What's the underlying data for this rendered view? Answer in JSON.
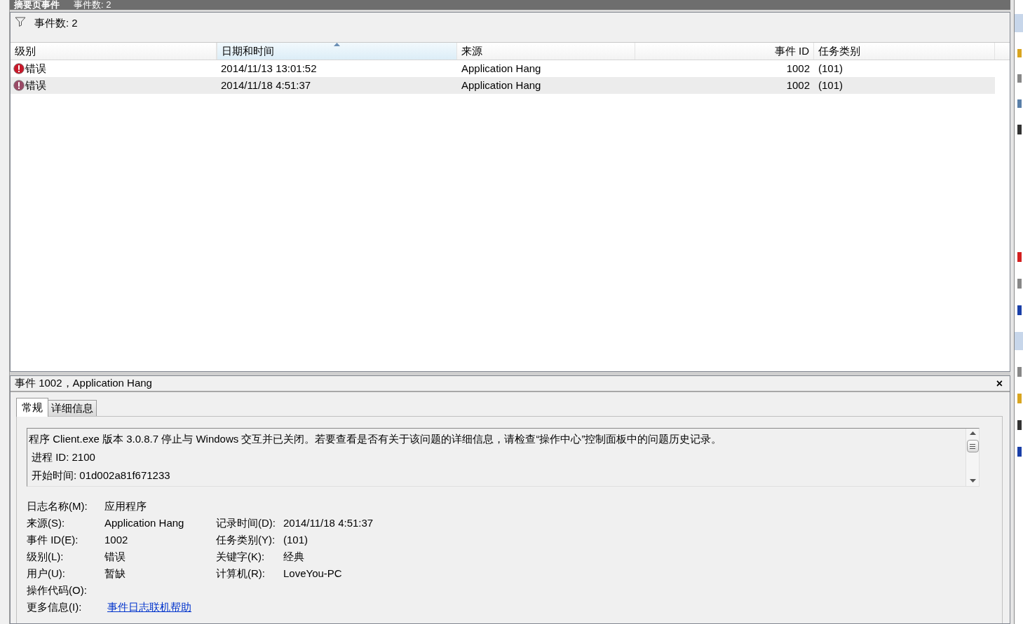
{
  "top_bar": {
    "title": "摘要页事件",
    "count": "事件数: 2"
  },
  "filter_bar": {
    "count": "事件数: 2"
  },
  "table": {
    "columns": [
      {
        "label": "级别",
        "sorted": false
      },
      {
        "label": "日期和时间",
        "sorted": true
      },
      {
        "label": "来源",
        "sorted": false
      },
      {
        "label": "事件 ID",
        "sorted": false
      },
      {
        "label": "任务类别",
        "sorted": false
      }
    ],
    "rows": [
      {
        "selected": false,
        "cells": [
          "错误",
          "2014/11/13 13:01:52",
          "Application Hang",
          "1002",
          "(101)"
        ]
      },
      {
        "selected": true,
        "cells": [
          "错误",
          "2014/11/18 4:51:37",
          "Application Hang",
          "1002",
          "(101)"
        ]
      }
    ]
  },
  "detail": {
    "title": "事件 1002，Application Hang",
    "close": "×",
    "tabs": [
      {
        "label": "常规",
        "selected": true
      },
      {
        "label": "详细信息",
        "selected": false
      }
    ],
    "description": [
      "程序 Client.exe 版本 3.0.8.7 停止与 Windows 交互并已关闭。若要查看是否有关于该问题的详细信息，请检查“操作中心”控制面板中的问题历史记录。",
      "进程 ID: 2100",
      "开始时间: 01d002a81f671233"
    ],
    "fields": [
      [
        {
          "label": "日志名称(M):",
          "value": "应用程序"
        }
      ],
      [
        {
          "label": "来源(S):",
          "value": "Application Hang"
        },
        {
          "label": "记录时间(D):",
          "value": "2014/11/18 4:51:37"
        }
      ],
      [
        {
          "label": "事件 ID(E):",
          "value": "1002"
        },
        {
          "label": "任务类别(Y):",
          "value": "(101)"
        }
      ],
      [
        {
          "label": "级别(L):",
          "value": "错误"
        },
        {
          "label": "关键字(K):",
          "value": "经典"
        }
      ],
      [
        {
          "label": "用户(U):",
          "value": "暂缺"
        },
        {
          "label": "计算机(R):",
          "value": "LoveYou-PC"
        }
      ],
      [
        {
          "label": "操作代码(O):"
        }
      ],
      [
        {
          "label": "更多信息(I):",
          "value": "事件日志联机帮助",
          "kind": "link"
        }
      ]
    ]
  }
}
